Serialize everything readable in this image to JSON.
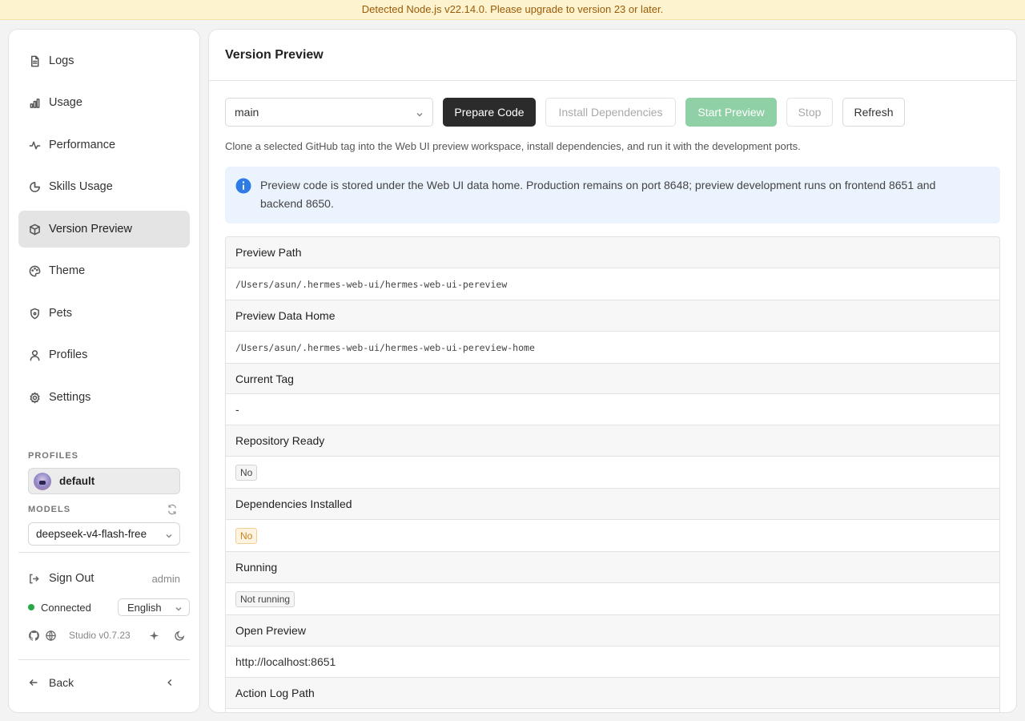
{
  "banner": {
    "text": "Detected Node.js v22.14.0. Please upgrade to version 23 or later."
  },
  "sidebar": {
    "items": [
      {
        "label": "Logs",
        "icon": "file-text-icon"
      },
      {
        "label": "Usage",
        "icon": "bar-chart-icon"
      },
      {
        "label": "Performance",
        "icon": "activity-icon"
      },
      {
        "label": "Skills Usage",
        "icon": "pie-chart-icon"
      },
      {
        "label": "Version Preview",
        "icon": "package-icon",
        "active": true
      },
      {
        "label": "Theme",
        "icon": "palette-icon"
      },
      {
        "label": "Pets",
        "icon": "shield-icon"
      },
      {
        "label": "Profiles",
        "icon": "user-icon"
      },
      {
        "label": "Settings",
        "icon": "gear-icon"
      }
    ],
    "profiles_label": "PROFILES",
    "profile_name": "default",
    "models_label": "MODELS",
    "model": "deepseek-v4-flash-free",
    "sign_out": "Sign Out",
    "user": "admin",
    "status": "Connected",
    "language": "English",
    "version": "Studio v0.7.23",
    "back": "Back"
  },
  "main": {
    "title": "Version Preview",
    "branch": "main",
    "buttons": {
      "prepare": "Prepare Code",
      "install": "Install Dependencies",
      "start": "Start Preview",
      "stop": "Stop",
      "refresh": "Refresh"
    },
    "description": "Clone a selected GitHub tag into the Web UI preview workspace, install dependencies, and run it with the development ports.",
    "info": "Preview code is stored under the Web UI data home. Production remains on port 8648; preview development runs on frontend 8651 and backend 8650.",
    "rows": {
      "preview_path_label": "Preview Path",
      "preview_path": "/Users/asun/.hermes-web-ui/hermes-web-ui-pereview",
      "data_home_label": "Preview Data Home",
      "data_home": "/Users/asun/.hermes-web-ui/hermes-web-ui-pereview-home",
      "current_tag_label": "Current Tag",
      "current_tag": "-",
      "repo_ready_label": "Repository Ready",
      "repo_ready": "No",
      "deps_label": "Dependencies Installed",
      "deps": "No",
      "running_label": "Running",
      "running": "Not running",
      "open_preview_label": "Open Preview",
      "open_preview": "http://localhost:8651",
      "action_log_label": "Action Log Path"
    }
  },
  "colors": {
    "accent_dark": "#2b2b2b",
    "start_green": "#8fd0a6",
    "info_bg": "#eaf3fe",
    "info_icon": "#2d7be5",
    "banner_bg": "#fdf3cf",
    "connected": "#28a745"
  }
}
